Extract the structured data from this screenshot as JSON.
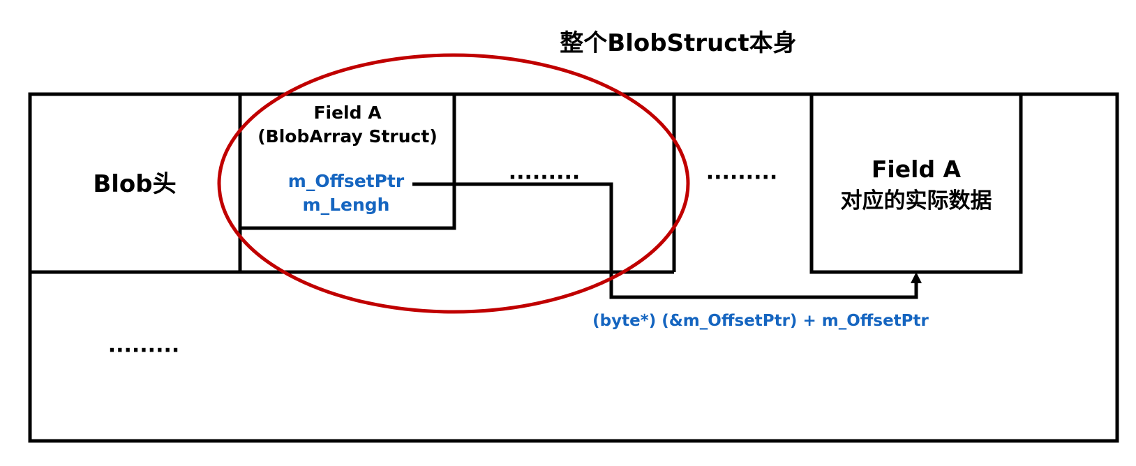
{
  "title": "整个BlobStruct本身",
  "labels": {
    "blob_header": "Blob头",
    "field_a_title": "Field A",
    "field_a_subtitle": "(BlobArray Struct)",
    "offset_ptr": "m_OffsetPtr",
    "length": "m_Lengh",
    "dots": "·········",
    "field_a_data_line1": "Field A",
    "field_a_data_line2": "对应的实际数据",
    "formula": "(byte*) (&m_OffsetPtr) + m_OffsetPtr"
  },
  "colors": {
    "stroke": "#000000",
    "ellipse": "#c00000",
    "accent_blue": "#1565c0"
  }
}
